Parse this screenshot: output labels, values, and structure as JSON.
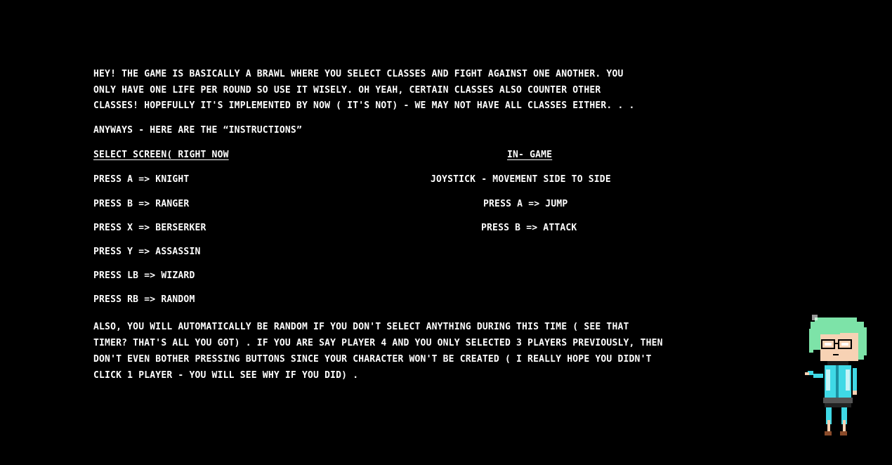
{
  "intro": {
    "lines": [
      "HEY!  THE GAME IS BASICALLY A BRAWL WHERE YOU SELECT CLASSES AND FIGHT AGAINST ONE ANOTHER.  YOU",
      "ONLY HAVE ONE LIFE PER ROUND SO USE IT WISELY.  OH YEAH,  CERTAIN CLASSES ALSO COUNTER OTHER",
      "CLASSES!  HOPEFULLY IT'S IMPLEMENTED BY NOW ( IT'S NOT)  - WE MAY NOT HAVE ALL CLASSES EITHER. . ."
    ]
  },
  "instructions_heading": "ANYWAYS - HERE ARE THE “INSTRUCTIONS”",
  "select_screen": {
    "heading": "SELECT SCREEN( RIGHT NOW",
    "items": [
      "PRESS A =>  KNIGHT",
      "PRESS B =>  RANGER",
      "PRESS X => BERSERKER",
      "PRESS Y => ASSASSIN",
      "PRESS LB => WIZARD",
      "PRESS RB => RANDOM"
    ]
  },
  "in_game": {
    "heading": "IN- GAME",
    "items": [
      "JOYSTICK - MOVEMENT SIDE TO SIDE",
      "PRESS A => JUMP",
      "PRESS B => ATTACK"
    ]
  },
  "footer": {
    "lines": [
      "ALSO,  YOU WILL AUTOMATICALLY BE RANDOM IF YOU DON'T SELECT ANYTHING DURING THIS TIME ( SEE THAT",
      "TIMER?  THAT'S ALL YOU GOT) .  IF YOU ARE SAY PLAYER 4 AND YOU ONLY SELECTED 3 PLAYERS PREVIOUSLY,  THEN",
      "DON'T EVEN BOTHER PRESSING BUTTONS SINCE YOUR CHARACTER WON'T BE CREATED ( I REALLY HOPE YOU DIDN'T",
      "CLICK 1 PLAYER - YOU WILL SEE WHY IF YOU DID) ."
    ]
  },
  "colors": {
    "background": "#000000",
    "text": "#ffffff",
    "character_hair": "#7de3a8",
    "character_outfit": "#3fd9e6"
  }
}
